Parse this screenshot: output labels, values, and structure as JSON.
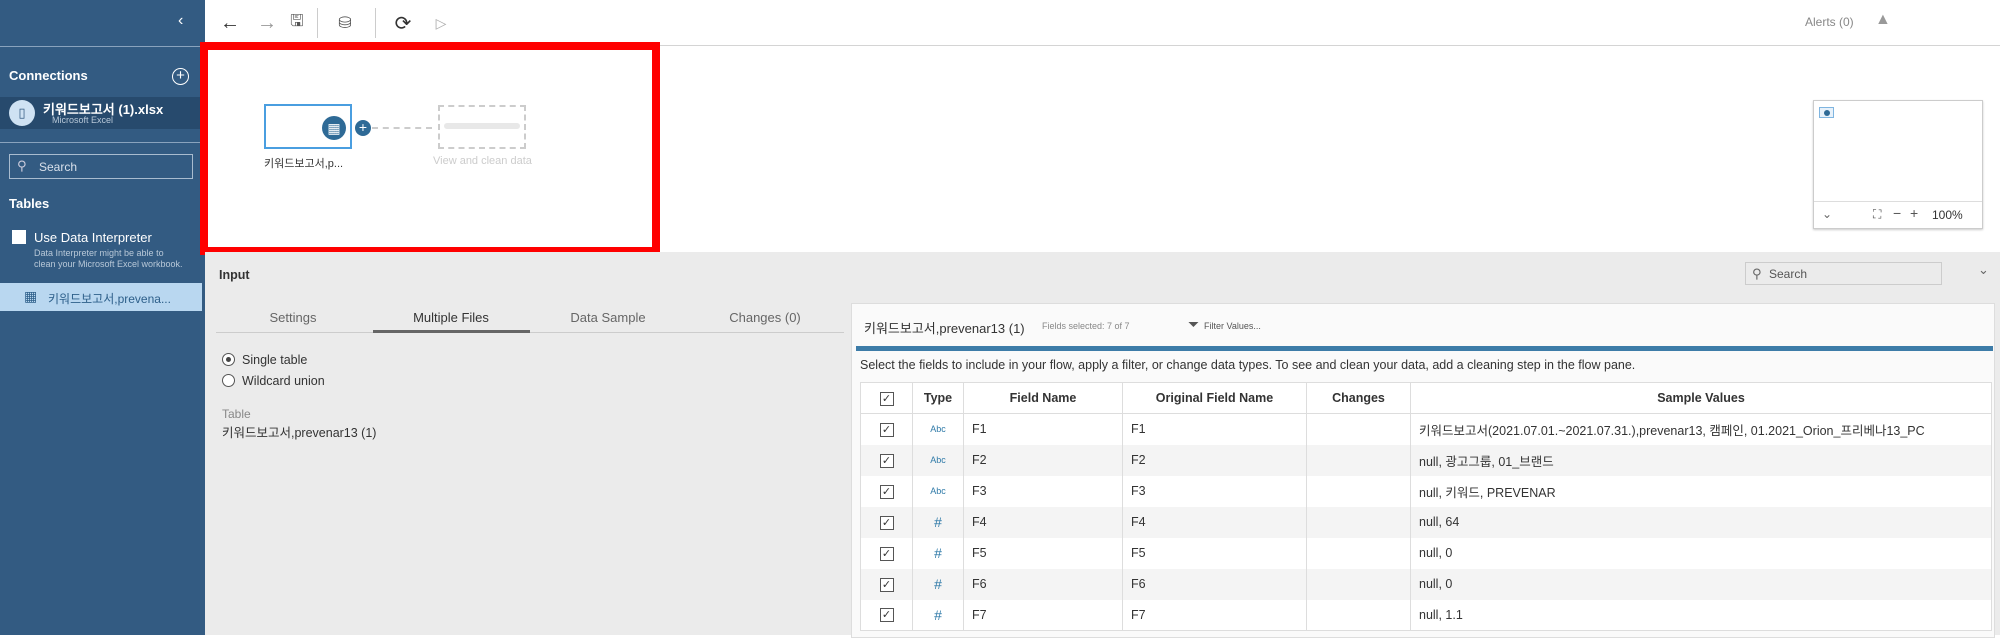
{
  "sidebar": {
    "collapse_icon": "chevron-left-icon",
    "connections_label": "Connections",
    "connection": {
      "name": "키워드보고서 (1).xlsx",
      "type": "Microsoft Excel"
    },
    "search_placeholder": "Search",
    "tables_label": "Tables",
    "interpreter_label": "Use Data Interpreter",
    "interpreter_help_1": "Data Interpreter might be able to",
    "interpreter_help_2": "clean your Microsoft Excel workbook.",
    "table_item": "키워드보고서,prevena..."
  },
  "toolbar": {
    "alerts": "Alerts (0)"
  },
  "flow": {
    "node_label": "키워드보고서,p...",
    "placeholder_label": "View and clean data",
    "zoom": "100%",
    "highlight_color": "#ff0000"
  },
  "input": {
    "title": "Input",
    "search_placeholder": "Search",
    "tabs": [
      "Settings",
      "Multiple Files",
      "Data Sample",
      "Changes (0)"
    ],
    "active_tab": "Multiple Files",
    "options": [
      "Single table",
      "Wildcard union"
    ],
    "selected_option": "Single table",
    "table_label": "Table",
    "table_value": "키워드보고서,prevenar13 (1)"
  },
  "fields": {
    "title": "키워드보고서,prevenar13 (1)",
    "selected": "Fields selected: 7 of 7",
    "filter": "Filter Values...",
    "description": "Select the fields to include in your flow, apply a filter, or change data types. To see and clean your data, add a cleaning step in the flow pane.",
    "columns": [
      "Type",
      "Field Name",
      "Original Field Name",
      "Changes",
      "Sample Values"
    ],
    "rows": [
      {
        "type": "Abc",
        "name": "F1",
        "orig": "F1",
        "changes": "",
        "sample": "키워드보고서(2021.07.01.~2021.07.31.),prevenar13, 캠페인, 01.2021_Orion_프리베나13_PC"
      },
      {
        "type": "Abc",
        "name": "F2",
        "orig": "F2",
        "changes": "",
        "sample": "null, 광고그룹, 01_브랜드"
      },
      {
        "type": "Abc",
        "name": "F3",
        "orig": "F3",
        "changes": "",
        "sample": "null, 키워드, PREVENAR"
      },
      {
        "type": "#",
        "name": "F4",
        "orig": "F4",
        "changes": "",
        "sample": "null, 64"
      },
      {
        "type": "#",
        "name": "F5",
        "orig": "F5",
        "changes": "",
        "sample": "null, 0"
      },
      {
        "type": "#",
        "name": "F6",
        "orig": "F6",
        "changes": "",
        "sample": "null, 0"
      },
      {
        "type": "#",
        "name": "F7",
        "orig": "F7",
        "changes": "",
        "sample": "null, 1.1"
      }
    ]
  }
}
